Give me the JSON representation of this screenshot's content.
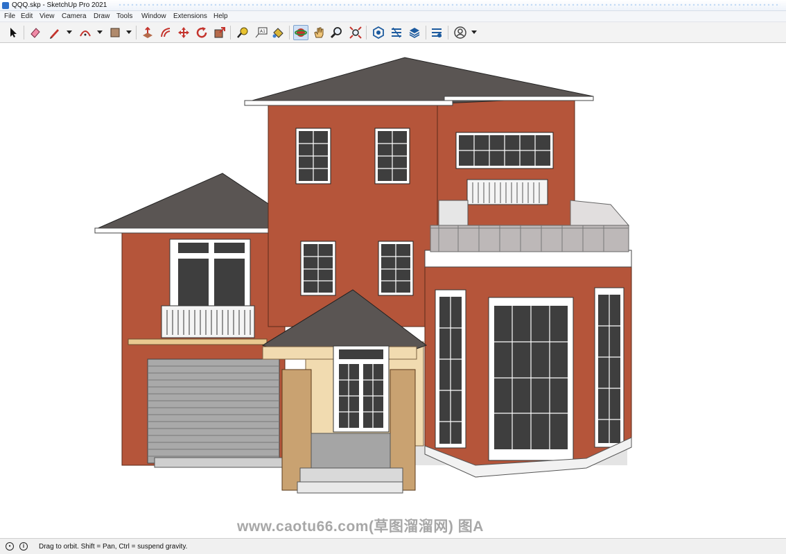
{
  "window": {
    "title": "QQQ.skp - SketchUp Pro 2021",
    "app_icon": "sketchup-logo-icon"
  },
  "menu": [
    "File",
    "Edit",
    "View",
    "Camera",
    "Draw",
    "Tools",
    "Window",
    "Extensions",
    "Help"
  ],
  "toolbar": {
    "tools": [
      {
        "name": "select",
        "icon": "arrow-cursor-icon"
      },
      {
        "name": "eraser",
        "icon": "eraser-icon"
      },
      {
        "name": "line",
        "icon": "pencil-icon"
      },
      {
        "name": "arc",
        "icon": "arc-icon"
      },
      {
        "name": "rectangle",
        "icon": "rectangle-icon"
      },
      {
        "name": "push-pull",
        "icon": "push-pull-icon"
      },
      {
        "name": "offset",
        "icon": "offset-icon"
      },
      {
        "name": "move",
        "icon": "move-icon"
      },
      {
        "name": "rotate",
        "icon": "rotate-icon"
      },
      {
        "name": "scale",
        "icon": "scale-icon"
      },
      {
        "name": "tape-measure",
        "icon": "tape-measure-icon"
      },
      {
        "name": "text",
        "icon": "text-icon"
      },
      {
        "name": "paint-bucket",
        "icon": "paint-bucket-icon"
      },
      {
        "name": "orbit",
        "icon": "orbit-icon",
        "active": true
      },
      {
        "name": "pan",
        "icon": "pan-hand-icon"
      },
      {
        "name": "zoom",
        "icon": "zoom-icon"
      },
      {
        "name": "zoom-extents",
        "icon": "zoom-extents-icon"
      },
      {
        "name": "3d-warehouse",
        "icon": "warehouse-icon"
      },
      {
        "name": "extension-warehouse",
        "icon": "extension-warehouse-icon"
      },
      {
        "name": "layout",
        "icon": "layers-stack-icon"
      },
      {
        "name": "extension-manager",
        "icon": "extension-manager-icon"
      },
      {
        "name": "account",
        "icon": "user-account-icon"
      }
    ],
    "active_tool": "orbit"
  },
  "viewport": {
    "model": "two-story brick house with hipped roofs, garage door, entry portico and bay window",
    "watermark": "www.caotu66.com(草图溜溜网) 图A",
    "colors": {
      "brick": "#b5553a",
      "roof": "#5a5553",
      "trim": "#ffffff",
      "glass": "#3e3e3e",
      "portico": "#f1dbb0",
      "garage": "#a9a9a9"
    }
  },
  "status": {
    "icons": [
      "geo-location-icon",
      "info-icon"
    ],
    "message": "Drag to orbit. Shift = Pan, Ctrl = suspend gravity."
  }
}
